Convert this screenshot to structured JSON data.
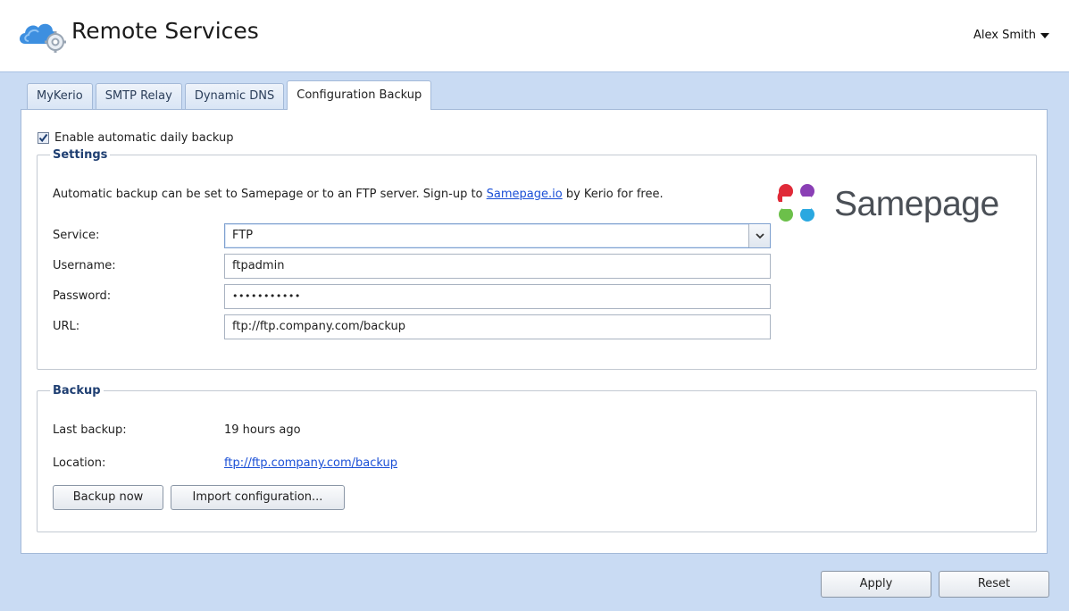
{
  "header": {
    "title": "Remote Services",
    "user": "Alex Smith"
  },
  "tabs": [
    {
      "label": "MyKerio",
      "active": false
    },
    {
      "label": "SMTP Relay",
      "active": false
    },
    {
      "label": "Dynamic DNS",
      "active": false
    },
    {
      "label": "Configuration Backup",
      "active": true
    }
  ],
  "enable_backup": {
    "label": "Enable automatic daily backup",
    "checked": true
  },
  "settings": {
    "legend": "Settings",
    "info_prefix": "Automatic backup can be set to Samepage or to an FTP server. Sign-up to ",
    "info_link": "Samepage.io",
    "info_suffix": " by Kerio for free.",
    "logo_text": "Samepage",
    "service_label": "Service:",
    "service_value": "FTP",
    "username_label": "Username:",
    "username_value": "ftpadmin",
    "password_label": "Password:",
    "password_value": "•••••••••••",
    "url_label": "URL:",
    "url_value": "ftp://ftp.company.com/backup"
  },
  "backup": {
    "legend": "Backup",
    "last_backup_label": "Last backup:",
    "last_backup_value": "19 hours ago",
    "location_label": "Location:",
    "location_value": "ftp://ftp.company.com/backup",
    "backup_now_label": "Backup now",
    "import_label": "Import configuration..."
  },
  "footer": {
    "apply_label": "Apply",
    "reset_label": "Reset"
  },
  "colors": {
    "workarea_bg": "#c9dbf3",
    "legend_blue": "#1f3f72",
    "link_blue": "#1a4fd6"
  }
}
